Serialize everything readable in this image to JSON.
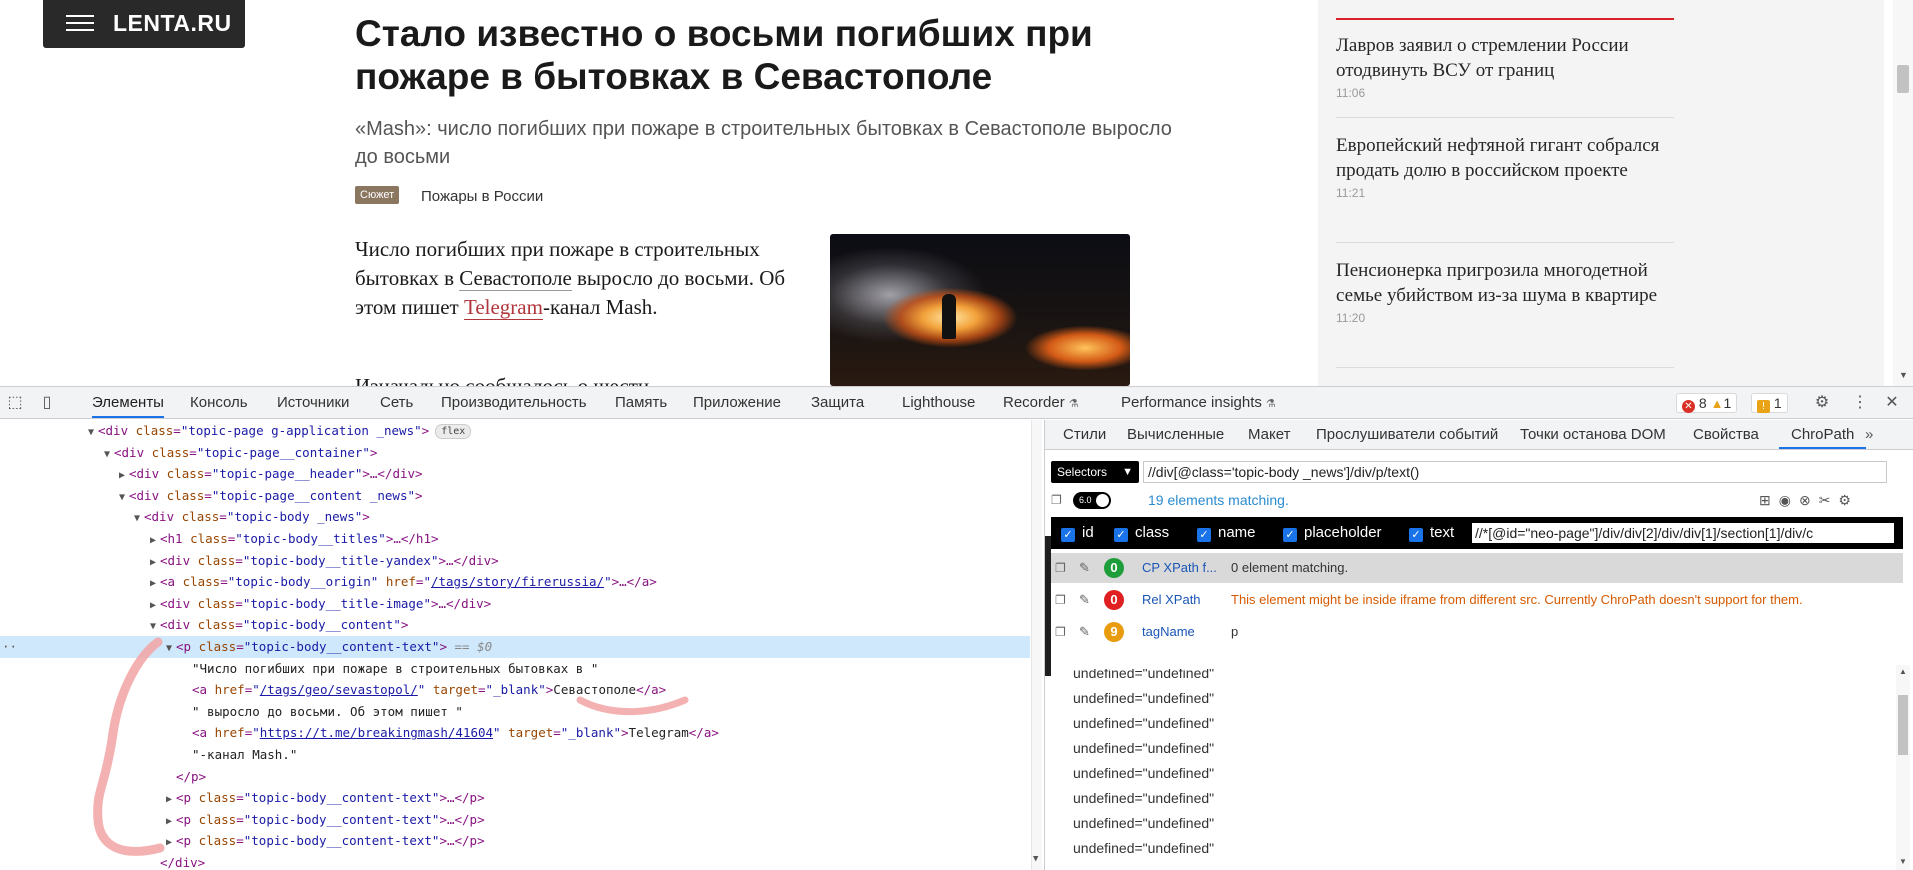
{
  "page": {
    "logo": "LENTA.RU",
    "title": "Стало известно о восьми погибших при пожаре в бытовках в Севастополе",
    "subtitle": "«Mash»: число погибших при пожаре в строительных бытовках в Севастополе выросло до восьми",
    "story_badge": "Сюжет",
    "story_title": "Пожары в России",
    "article_p1_a": "Число погибших при пожаре в строительных бытовках в ",
    "article_p1_link1": "Севастополе",
    "article_p1_b": " выросло до восьми. Об этом пишет ",
    "article_p1_link2": "Telegram",
    "article_p1_c": "-канал Mash.",
    "article_p2": "Изначально сообщалось о шести",
    "sidebar_news": [
      {
        "headline": "Лавров заявил о стремлении России отодвинуть ВСУ от границ",
        "time": "11:06"
      },
      {
        "headline": "Европейский нефтяной гигант собрался продать долю в российском проекте",
        "time": "11:21"
      },
      {
        "headline": "Пенсионерка пригрозила многодетной семье убийством из-за шума в квартире",
        "time": "11:20"
      }
    ]
  },
  "devtools": {
    "tabs": [
      "Элементы",
      "Консоль",
      "Источники",
      "Сеть",
      "Производительность",
      "Память",
      "Приложение",
      "Защита",
      "Lighthouse",
      "Recorder",
      "Performance insights"
    ],
    "errors": "8",
    "warnings": "1",
    "issues": "1",
    "dom": {
      "l0_class": "topic-page g-application _news",
      "l0_pill": "flex",
      "l1_class": "topic-page__container",
      "l2_class": "topic-page__header",
      "l3_class": "topic-page__content _news",
      "l4_class": "topic-body _news",
      "l5_class": "topic-body__titles",
      "l6_class": "topic-body__title-yandex",
      "l7_class": "topic-body__origin",
      "l7_href": "/tags/story/firerussia/",
      "l8_class": "topic-body__title-image",
      "l9_class": "topic-body__content",
      "l10_class": "topic-body__content-text",
      "l10_eq": "== $0",
      "t1": "\"Число погибших при пожаре в строительных бытовках в \"",
      "l12_href": "/tags/geo/sevastopol/",
      "l12_target": "_blank",
      "l12_text": "Севастополе",
      "t2": "\" выросло до восьми. Об этом пишет \"",
      "l14_href": "https://t.me/breakingmash/41604",
      "l14_target": "_blank",
      "l14_text": "Telegram",
      "t3": "\"-канал Mash.\"",
      "l17_class": "topic-body__content-text",
      "l18_class": "topic-body__content-text",
      "l19_class": "topic-body__content-text"
    },
    "right_tabs": [
      "Стили",
      "Вычисленные",
      "Макет",
      "Прослушиватели событий",
      "Точки останова DOM",
      "Свойства",
      "ChroPath"
    ],
    "chropath": {
      "selector_type": "Selectors",
      "selector_value": "//div[@class='topic-body _news']/div/p/text()",
      "version": "6.0",
      "matching": "19 elements matching.",
      "attrs": [
        "id",
        "class",
        "name",
        "placeholder",
        "text"
      ],
      "attr_xpath": "//*[@id=\"neo-page\"]/div/div[2]/div/div[1]/section[1]/div/c",
      "rows": [
        {
          "count": "0",
          "color": "#1e9e3a",
          "label": "CP XPath f...",
          "message": "0 element matching."
        },
        {
          "count": "0",
          "color": "#e02020",
          "label": "Rel XPath",
          "message": "This element might be inside iframe from different src. Currently ChroPath doesn't support for them."
        },
        {
          "count": "9",
          "color": "#e89b0c",
          "label": "tagName",
          "message": "p"
        }
      ],
      "results": [
        "undefined=\"undefined\"",
        "undefined=\"undefined\"",
        "undefined=\"undefined\"",
        "undefined=\"undefined\"",
        "undefined=\"undefined\"",
        "undefined=\"undefined\"",
        "undefined=\"undefined\"",
        "undefined=\"undefined\""
      ]
    }
  }
}
